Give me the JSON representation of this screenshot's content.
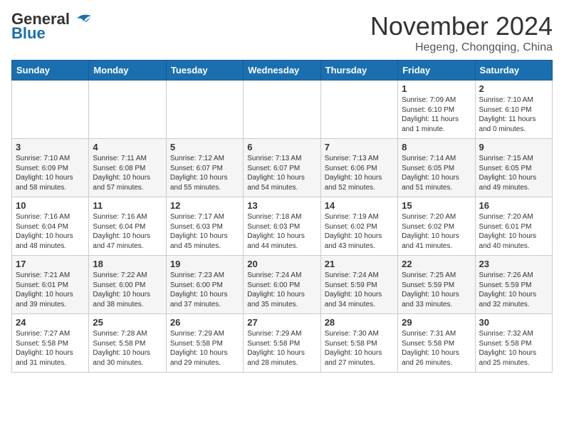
{
  "header": {
    "logo_line1": "General",
    "logo_line2": "Blue",
    "month": "November 2024",
    "location": "Hegeng, Chongqing, China"
  },
  "weekdays": [
    "Sunday",
    "Monday",
    "Tuesday",
    "Wednesday",
    "Thursday",
    "Friday",
    "Saturday"
  ],
  "weeks": [
    [
      {
        "day": "",
        "info": ""
      },
      {
        "day": "",
        "info": ""
      },
      {
        "day": "",
        "info": ""
      },
      {
        "day": "",
        "info": ""
      },
      {
        "day": "",
        "info": ""
      },
      {
        "day": "1",
        "info": "Sunrise: 7:09 AM\nSunset: 6:10 PM\nDaylight: 11 hours\nand 1 minute."
      },
      {
        "day": "2",
        "info": "Sunrise: 7:10 AM\nSunset: 6:10 PM\nDaylight: 11 hours\nand 0 minutes."
      }
    ],
    [
      {
        "day": "3",
        "info": "Sunrise: 7:10 AM\nSunset: 6:09 PM\nDaylight: 10 hours\nand 58 minutes."
      },
      {
        "day": "4",
        "info": "Sunrise: 7:11 AM\nSunset: 6:08 PM\nDaylight: 10 hours\nand 57 minutes."
      },
      {
        "day": "5",
        "info": "Sunrise: 7:12 AM\nSunset: 6:07 PM\nDaylight: 10 hours\nand 55 minutes."
      },
      {
        "day": "6",
        "info": "Sunrise: 7:13 AM\nSunset: 6:07 PM\nDaylight: 10 hours\nand 54 minutes."
      },
      {
        "day": "7",
        "info": "Sunrise: 7:13 AM\nSunset: 6:06 PM\nDaylight: 10 hours\nand 52 minutes."
      },
      {
        "day": "8",
        "info": "Sunrise: 7:14 AM\nSunset: 6:05 PM\nDaylight: 10 hours\nand 51 minutes."
      },
      {
        "day": "9",
        "info": "Sunrise: 7:15 AM\nSunset: 6:05 PM\nDaylight: 10 hours\nand 49 minutes."
      }
    ],
    [
      {
        "day": "10",
        "info": "Sunrise: 7:16 AM\nSunset: 6:04 PM\nDaylight: 10 hours\nand 48 minutes."
      },
      {
        "day": "11",
        "info": "Sunrise: 7:16 AM\nSunset: 6:04 PM\nDaylight: 10 hours\nand 47 minutes."
      },
      {
        "day": "12",
        "info": "Sunrise: 7:17 AM\nSunset: 6:03 PM\nDaylight: 10 hours\nand 45 minutes."
      },
      {
        "day": "13",
        "info": "Sunrise: 7:18 AM\nSunset: 6:03 PM\nDaylight: 10 hours\nand 44 minutes."
      },
      {
        "day": "14",
        "info": "Sunrise: 7:19 AM\nSunset: 6:02 PM\nDaylight: 10 hours\nand 43 minutes."
      },
      {
        "day": "15",
        "info": "Sunrise: 7:20 AM\nSunset: 6:02 PM\nDaylight: 10 hours\nand 41 minutes."
      },
      {
        "day": "16",
        "info": "Sunrise: 7:20 AM\nSunset: 6:01 PM\nDaylight: 10 hours\nand 40 minutes."
      }
    ],
    [
      {
        "day": "17",
        "info": "Sunrise: 7:21 AM\nSunset: 6:01 PM\nDaylight: 10 hours\nand 39 minutes."
      },
      {
        "day": "18",
        "info": "Sunrise: 7:22 AM\nSunset: 6:00 PM\nDaylight: 10 hours\nand 38 minutes."
      },
      {
        "day": "19",
        "info": "Sunrise: 7:23 AM\nSunset: 6:00 PM\nDaylight: 10 hours\nand 37 minutes."
      },
      {
        "day": "20",
        "info": "Sunrise: 7:24 AM\nSunset: 6:00 PM\nDaylight: 10 hours\nand 35 minutes."
      },
      {
        "day": "21",
        "info": "Sunrise: 7:24 AM\nSunset: 5:59 PM\nDaylight: 10 hours\nand 34 minutes."
      },
      {
        "day": "22",
        "info": "Sunrise: 7:25 AM\nSunset: 5:59 PM\nDaylight: 10 hours\nand 33 minutes."
      },
      {
        "day": "23",
        "info": "Sunrise: 7:26 AM\nSunset: 5:59 PM\nDaylight: 10 hours\nand 32 minutes."
      }
    ],
    [
      {
        "day": "24",
        "info": "Sunrise: 7:27 AM\nSunset: 5:58 PM\nDaylight: 10 hours\nand 31 minutes."
      },
      {
        "day": "25",
        "info": "Sunrise: 7:28 AM\nSunset: 5:58 PM\nDaylight: 10 hours\nand 30 minutes."
      },
      {
        "day": "26",
        "info": "Sunrise: 7:29 AM\nSunset: 5:58 PM\nDaylight: 10 hours\nand 29 minutes."
      },
      {
        "day": "27",
        "info": "Sunrise: 7:29 AM\nSunset: 5:58 PM\nDaylight: 10 hours\nand 28 minutes."
      },
      {
        "day": "28",
        "info": "Sunrise: 7:30 AM\nSunset: 5:58 PM\nDaylight: 10 hours\nand 27 minutes."
      },
      {
        "day": "29",
        "info": "Sunrise: 7:31 AM\nSunset: 5:58 PM\nDaylight: 10 hours\nand 26 minutes."
      },
      {
        "day": "30",
        "info": "Sunrise: 7:32 AM\nSunset: 5:58 PM\nDaylight: 10 hours\nand 25 minutes."
      }
    ]
  ]
}
